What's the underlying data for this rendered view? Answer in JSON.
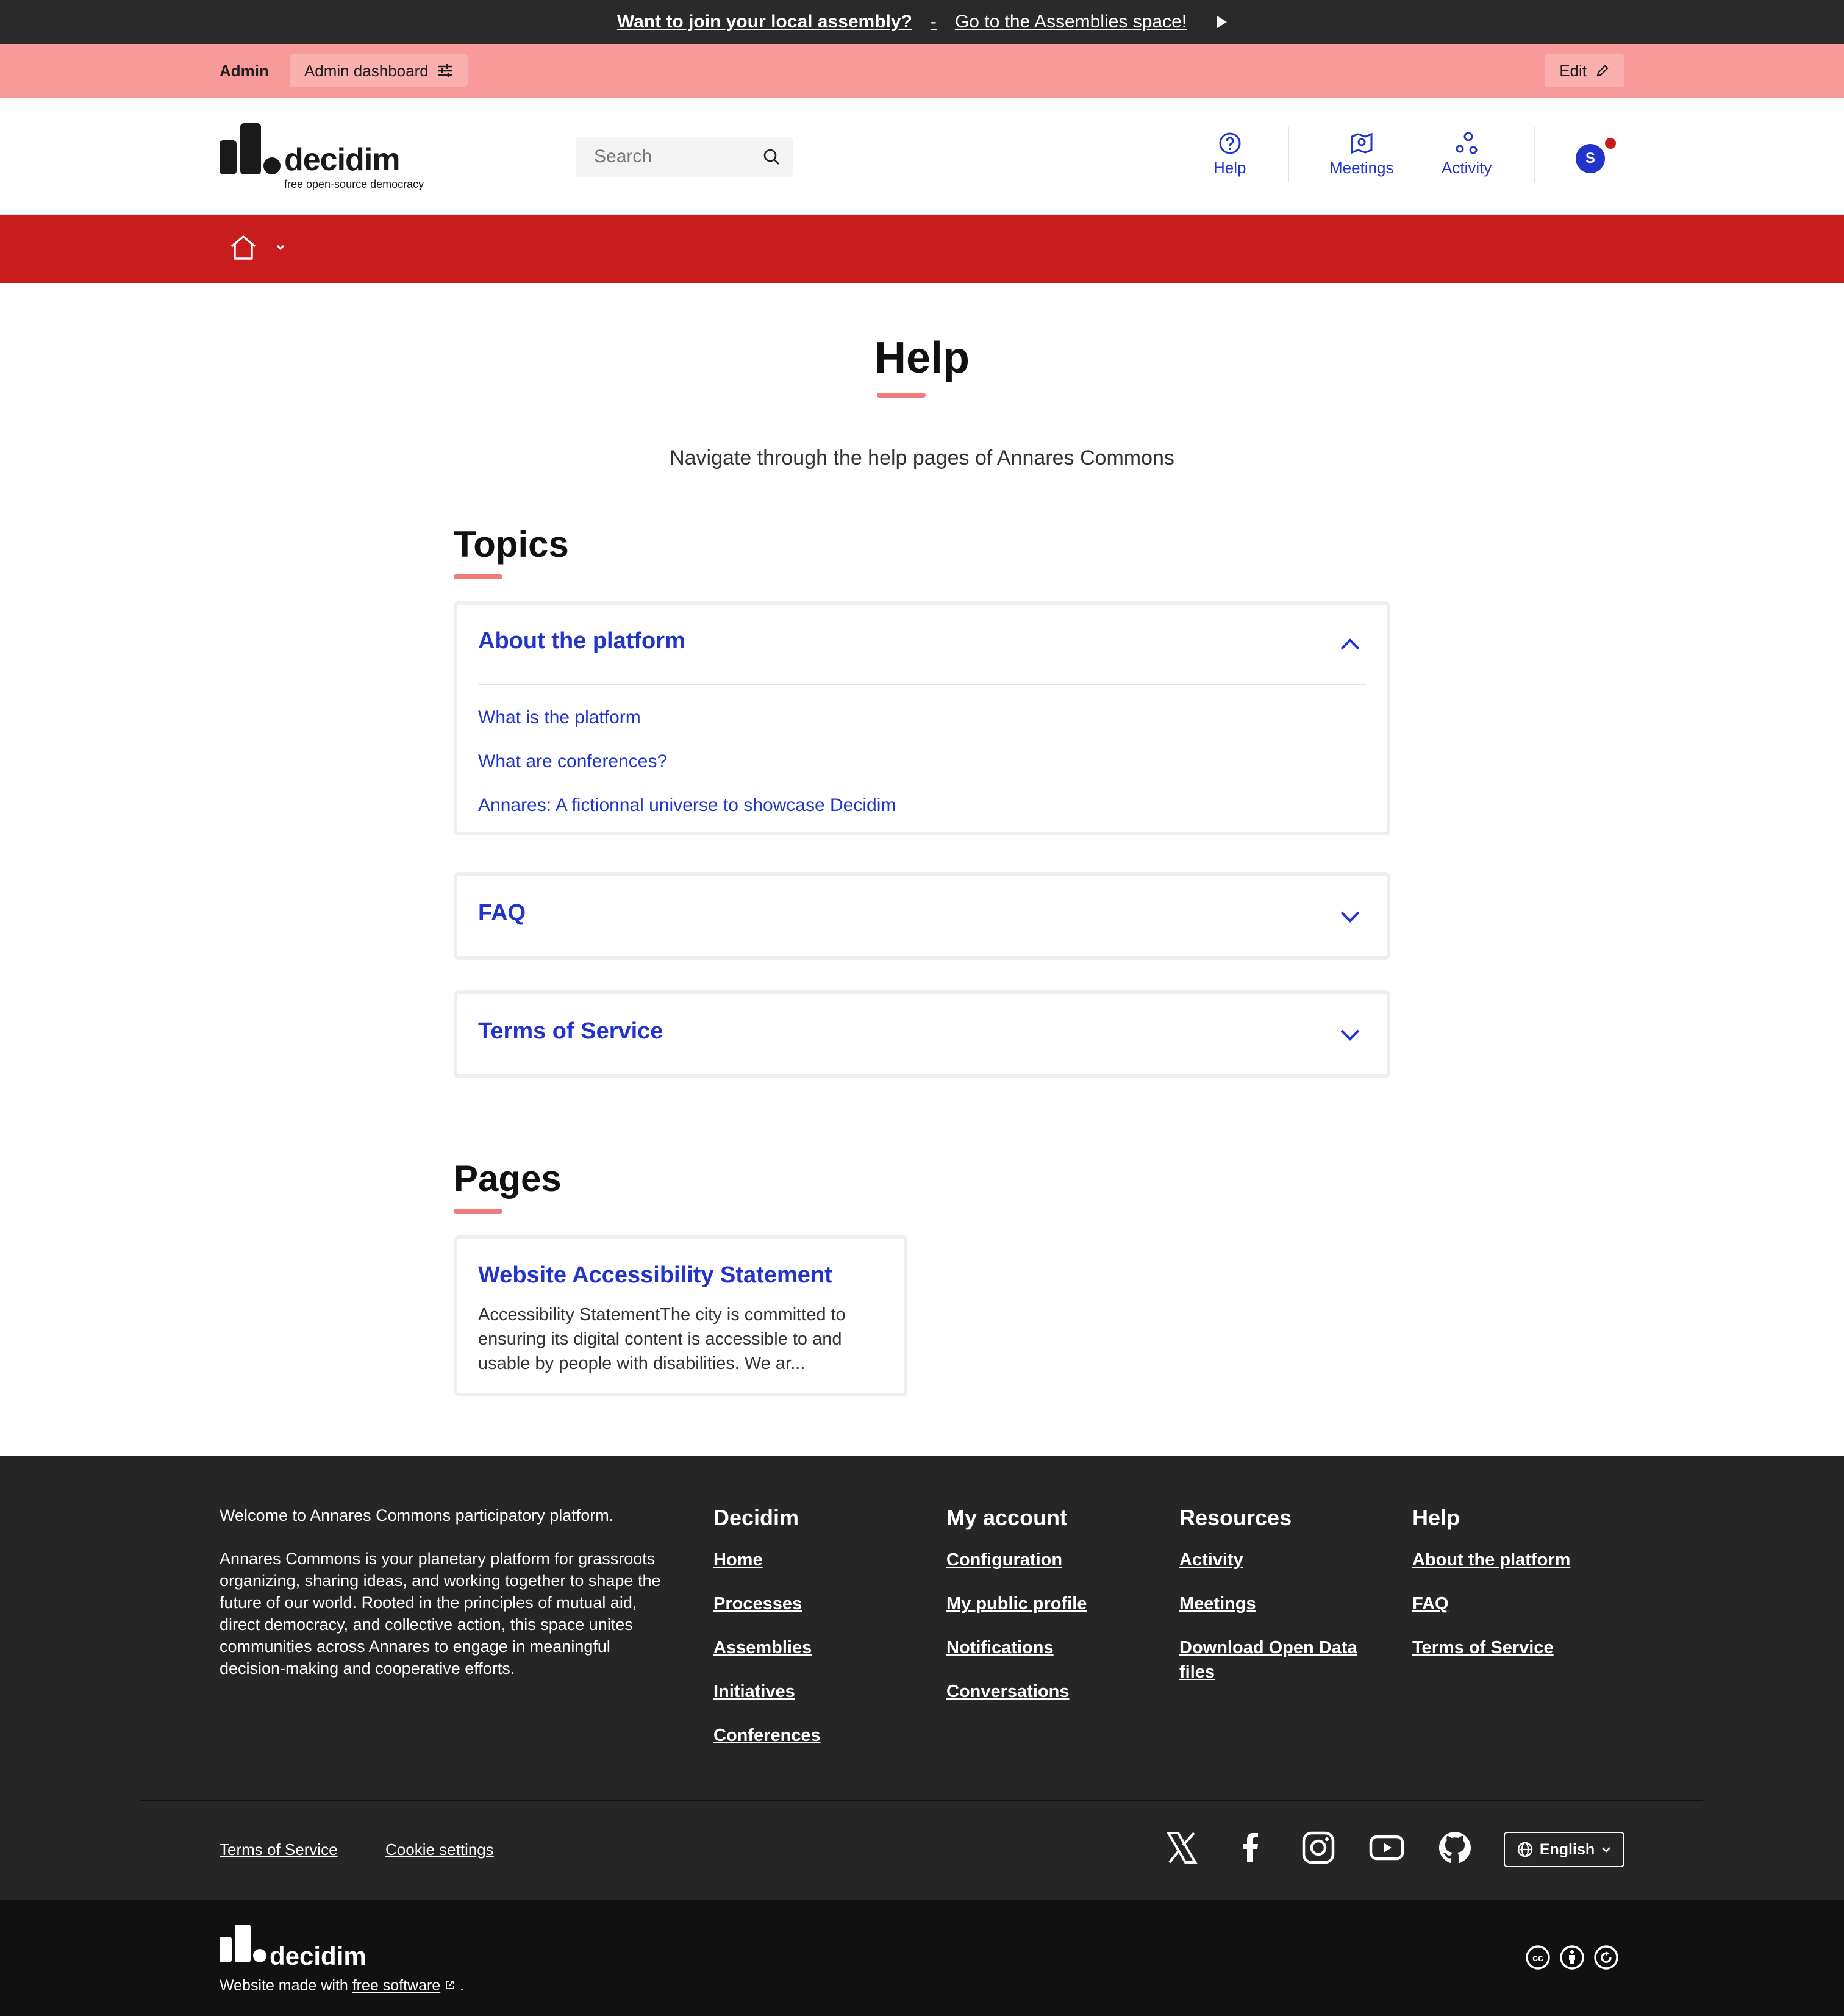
{
  "announcement": {
    "lead": "Want to join your local assembly?",
    "sep": "-",
    "link": "Go to the Assemblies space!"
  },
  "admin_bar": {
    "label": "Admin",
    "dashboard": "Admin dashboard",
    "edit": "Edit"
  },
  "header": {
    "logo_word": "decidim",
    "logo_tagline": "free open-source democracy",
    "search_placeholder": "Search",
    "nav": [
      {
        "label": "Help",
        "icon": "help-circle-icon"
      },
      {
        "label": "Meetings",
        "icon": "map-pin-icon"
      },
      {
        "label": "Activity",
        "icon": "activity-icon"
      }
    ],
    "user_initial": "S"
  },
  "main": {
    "title": "Help",
    "subtitle": "Navigate through the help pages of Annares Commons",
    "topics_heading": "Topics",
    "topics": [
      {
        "title": "About the platform",
        "expanded": true,
        "links": [
          "What is the platform",
          "What are conferences?",
          "Annares: A fictionnal universe to showcase Decidim"
        ]
      },
      {
        "title": "FAQ",
        "expanded": false
      },
      {
        "title": "Terms of Service",
        "expanded": false
      }
    ],
    "pages_heading": "Pages",
    "pages": [
      {
        "title": "Website Accessibility Statement",
        "excerpt": "Accessibility StatementThe city is committed to ensuring its digital content is accessible to and usable by people with disabilities. We ar..."
      }
    ]
  },
  "footer": {
    "welcome": "Welcome to Annares Commons participatory platform.",
    "about": "Annares Commons is your planetary platform for grassroots organizing, sharing ideas, and working together to shape the future of our world. Rooted in the principles of mutual aid, direct democracy, and collective action, this space unites communities across Annares to engage in meaningful decision-making and cooperative efforts.",
    "columns": [
      {
        "heading": "Decidim",
        "links": [
          "Home",
          "Processes",
          "Assemblies",
          "Initiatives",
          "Conferences"
        ]
      },
      {
        "heading": "My account",
        "links": [
          "Configuration",
          "My public profile",
          "Notifications",
          "Conversations"
        ]
      },
      {
        "heading": "Resources",
        "links": [
          "Activity",
          "Meetings",
          "Download Open Data files"
        ]
      },
      {
        "heading": "Help",
        "links": [
          "About the platform",
          "FAQ",
          "Terms of Service"
        ]
      }
    ],
    "bottom_links": [
      "Terms of Service",
      "Cookie settings"
    ],
    "social": [
      "x-icon",
      "facebook-icon",
      "instagram-icon",
      "youtube-icon",
      "github-icon"
    ],
    "language": "English"
  },
  "bottom_bar": {
    "logo_word": "decidim",
    "made_with": "Website made with",
    "free_software": "free software",
    "period": "."
  },
  "colors": {
    "accent_blue": "#2234c9",
    "brand_red": "#c91d1d",
    "admin_pink": "#f99a9a",
    "footer_dark": "#262626"
  }
}
